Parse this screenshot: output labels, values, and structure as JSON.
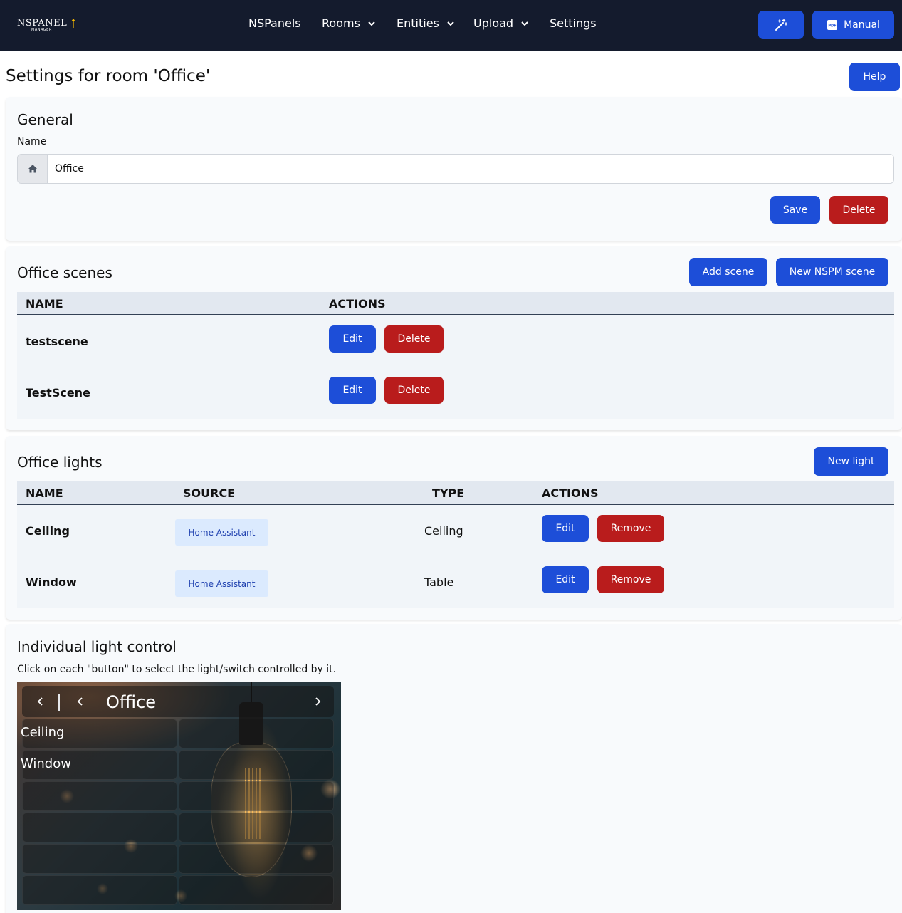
{
  "navbar": {
    "logo_text": "NSPANEL",
    "logo_sub": "MANAGER",
    "items": [
      {
        "label": "NSPanels"
      },
      {
        "label": "Rooms"
      },
      {
        "label": "Entities"
      },
      {
        "label": "Upload"
      },
      {
        "label": "Settings"
      }
    ],
    "manual_label": "Manual"
  },
  "page": {
    "title": "Settings for room 'Office'",
    "help_label": "Help"
  },
  "general": {
    "title": "General",
    "name_label": "Name",
    "name_value": "Office",
    "save_label": "Save",
    "delete_label": "Delete"
  },
  "scenes": {
    "title": "Office scenes",
    "add_label": "Add scene",
    "new_label": "New NSPM scene",
    "headers": [
      "NAME",
      "ACTIONS"
    ],
    "rows": [
      {
        "name": "testscene",
        "edit": "Edit",
        "delete": "Delete"
      },
      {
        "name": "TestScene",
        "edit": "Edit",
        "delete": "Delete"
      }
    ]
  },
  "lights": {
    "title": "Office lights",
    "new_label": "New light",
    "headers": [
      "NAME",
      "SOURCE",
      "TYPE",
      "ACTIONS"
    ],
    "rows": [
      {
        "name": "Ceiling",
        "source": "Home Assistant",
        "type": "Ceiling",
        "edit": "Edit",
        "remove": "Remove"
      },
      {
        "name": "Window",
        "source": "Home Assistant",
        "type": "Table",
        "edit": "Edit",
        "remove": "Remove"
      }
    ]
  },
  "control": {
    "title": "Individual light control",
    "description": "Click on each \"button\" to select the light/switch controlled by it.",
    "panel_title": "Office",
    "cells": [
      "Ceiling",
      "Window"
    ]
  },
  "colors": {
    "navbar": "#141b2d",
    "primary": "#1d4ed8",
    "danger": "#b91c1c",
    "badge_bg": "#dbeafe",
    "badge_text": "#1e40af"
  }
}
